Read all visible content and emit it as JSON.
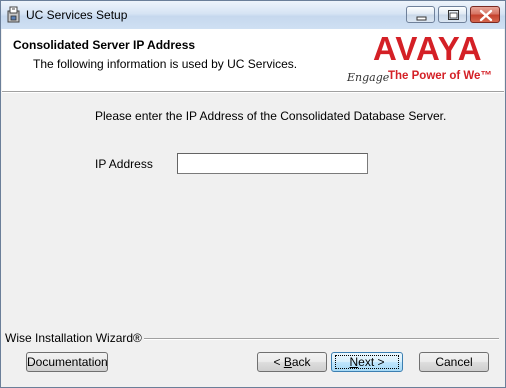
{
  "window": {
    "title": "UC Services Setup"
  },
  "header": {
    "title": "Consolidated Server IP Address",
    "subtitle": "The following information is used by UC Services.",
    "logo_text": "AVAYA",
    "tagline_script": "Engage",
    "tagline": "The Power of We™"
  },
  "body": {
    "prompt": "Please enter the IP Address of the Consolidated Database Server.",
    "ip_label": "IP Address",
    "ip_value": ""
  },
  "footer": {
    "wizard_label": "Wise Installation Wizard®",
    "documentation_label": "Documentation",
    "back_mnemonic": "B",
    "back_rest": "ack",
    "back_prefix": "< ",
    "next_mnemonic": "N",
    "next_rest": "ext >",
    "cancel_label": "Cancel"
  },
  "colors": {
    "brand_red": "#d42026",
    "titlebar": "#d6e4f4",
    "focus_button_border": "#3c7fb1"
  },
  "icons": [
    "installer-icon",
    "minimize-icon",
    "maximize-icon",
    "close-icon"
  ]
}
